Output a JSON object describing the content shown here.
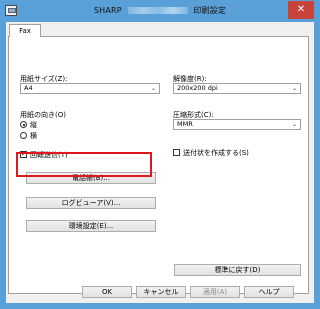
{
  "window": {
    "title_left": "SHARP",
    "title_right": "印刷設定",
    "close_glyph": "✕"
  },
  "tabs": [
    {
      "label": "Fax"
    }
  ],
  "left": {
    "paper_size_label": "用紙サイズ(Z):",
    "paper_size_value": "A4",
    "orientation_label": "用紙の向き(O)",
    "orientation_options": [
      "縦",
      "横"
    ],
    "rotate_send_label": "回転送信(T)",
    "phonebook_button": "電話帳(B)...",
    "log_viewer_button": "ログビューア(V)...",
    "env_settings_button": "環境設定(E)..."
  },
  "right": {
    "resolution_label": "解像度(R):",
    "resolution_value": "200x200 dpi",
    "compression_label": "圧縮形式(C):",
    "compression_value": "MMR",
    "cover_sheet_label": "送付状を作成する(S)",
    "restore_defaults_button": "標準に戻す(D)"
  },
  "footer": {
    "ok": "OK",
    "cancel": "キャンセル",
    "apply": "適用(A)",
    "help": "ヘルプ"
  }
}
